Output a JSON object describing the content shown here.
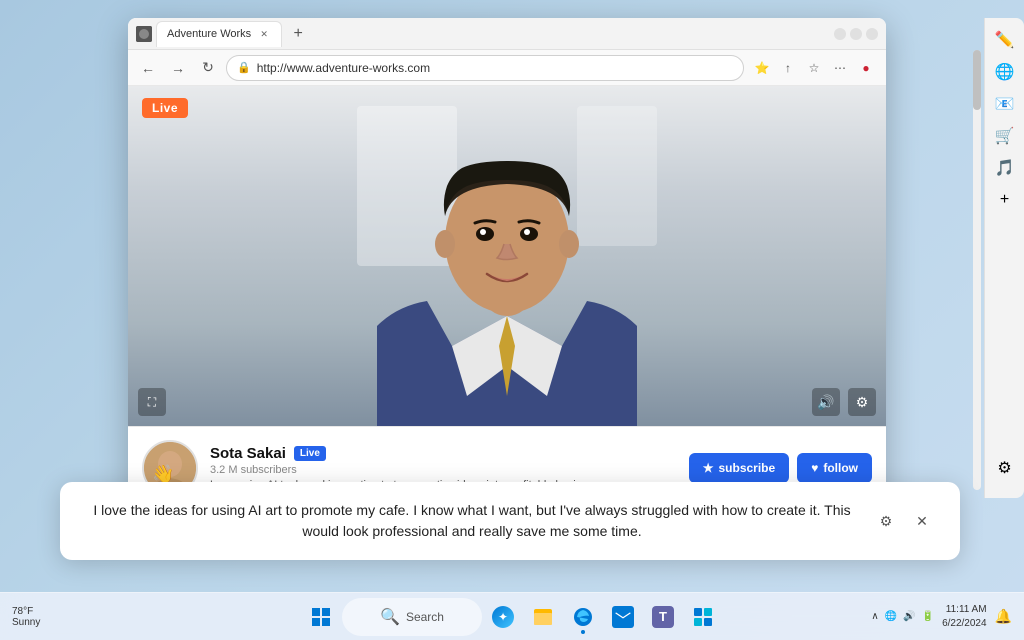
{
  "browser": {
    "tab_title": "Adventure Works",
    "url": "http://www.adventure-works.com",
    "window_controls": {
      "minimize": "—",
      "maximize": "□",
      "close": "✕"
    }
  },
  "video": {
    "live_badge": "Live",
    "channel_name": "Sota Sakai",
    "live_tag": "Live",
    "subscribers": "3.2 M subscribers",
    "description": "Leveraging AI tools and innovation to turn creative ideas into profitable business.",
    "subscribe_label": "subscribe",
    "follow_label": "follow"
  },
  "ai_popup": {
    "text": "I love the ideas for using AI art to promote my cafe. I know what I want, but I've always struggled with how to create it. This would look professional and really save me some time."
  },
  "taskbar": {
    "weather": "78°F",
    "weather_condition": "Sunny",
    "search_placeholder": "Search",
    "time": "11:11 AM",
    "date": "6/22/2024"
  },
  "sidebar_icons": [
    "✏️",
    "🌐",
    "📧",
    "🛒",
    "🎵",
    "+"
  ],
  "nav_buttons": {
    "back": "←",
    "forward": "→",
    "refresh": "↻"
  }
}
